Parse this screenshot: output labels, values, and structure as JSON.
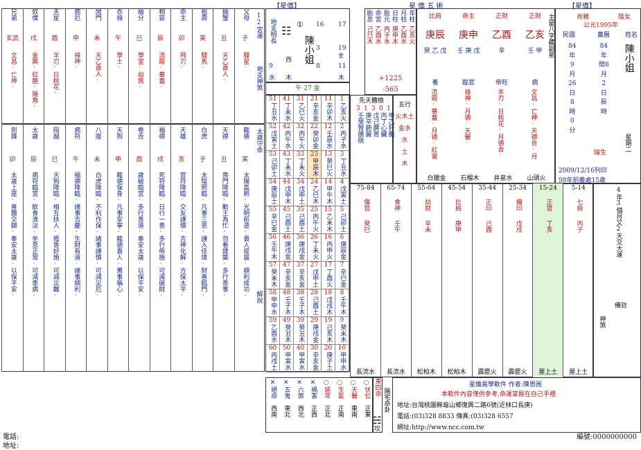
{
  "header": {
    "left": "【星僑】",
    "center": "星 僑 五 術",
    "right": "【星僑】"
  },
  "palaces_top": [
    {
      "name": "兄弟",
      "star": "玄武",
      "stem": "",
      "sub": "文昌·亡神·"
    },
    {
      "name": "奴僕",
      "star": "戌",
      "stem": "",
      "sub": "金輿·紅艷·陽角·"
    },
    {
      "name": "夫星",
      "star": "酉",
      "stem": "",
      "sub": "羊刃·日桃花·"
    },
    {
      "name": "病厄",
      "star": "申",
      "stem": "",
      "sub": "祿神·"
    },
    {
      "name": "閒門",
      "star": "未",
      "stem": "",
      "sub": "天乙貴人·"
    },
    {
      "name": "衣祿",
      "star": "午",
      "stem": "",
      "sub": "學士·"
    },
    {
      "name": "福分",
      "star": "巳",
      "stem": "",
      "sub": "學堂·劫煞·"
    },
    {
      "name": "相容",
      "star": "辰",
      "stem": "",
      "sub": "流霞·華蓋·"
    },
    {
      "name": "命主",
      "star": "卯",
      "stem": "",
      "sub": "飛刃·"
    },
    {
      "name": "祖壽",
      "star": "寅",
      "stem": "",
      "sub": "驛馬·"
    },
    {
      "name": "抽蟹",
      "star": "丑",
      "stem": "",
      "sub": "天乙貴人·"
    },
    {
      "name": "父母",
      "star": "子",
      "stem": "",
      "sub": "驛星·"
    }
  ],
  "palaces_mid": [
    {
      "name": "劍鋒",
      "b": "卯",
      "txt": "太歲上座·喜鵲交錦·奉安太歲·以保平安·"
    },
    {
      "name": "太歲",
      "b": "辰",
      "txt": "病符臨宮·飲食清淡·坐息正常·可減患病·"
    },
    {
      "name": "陌越",
      "b": "巳",
      "txt": "天狗降臨·相互扶人·擔香好施·可減災難·"
    },
    {
      "name": "病符",
      "b": "午",
      "txt": "福德降臨·諸事吉慶·生財有道·諸事順利·"
    },
    {
      "name": "八座",
      "b": "未",
      "txt": "白虎降臨·不利作保·諸事謹慎·可減災厄·"
    },
    {
      "name": "天狗",
      "b": "申",
      "txt": "龍德保身·凡事安寧·龍德貴人·萬事稱心·"
    },
    {
      "name": "卷舌",
      "b": "酉",
      "txt": "歲破臨宮·多行善道·奉安太歲·以保平安·"
    },
    {
      "name": "福德",
      "b": "戌",
      "txt": "死符降臨·日行一善·多行佈施·可減破財·"
    },
    {
      "name": "天雄",
      "b": "亥",
      "txt": "官符降臨·交友謹慎·吉神化解·方保太平·"
    },
    {
      "name": "白虎",
      "b": "子",
      "txt": "太陰照臨·凡事三思·謹入佳境·財喜臨門·"
    },
    {
      "name": "天德",
      "b": "丑",
      "txt": "喪門降臨·勤王為忙·勿看建築·多行善事·"
    },
    {
      "name": "龍德",
      "b": "寅",
      "txt": "太陽高照·光明前途·貴人提拔·順利成功·"
    }
  ],
  "left_labels": {
    "yunqi": "12宮運",
    "dizhi": "地支神煞",
    "taisui": "太歲守命",
    "jieshuo": "解說"
  },
  "name_block": {
    "circle": "①",
    "name": "陳小姐",
    "left_col": "地支明長",
    "nums_top": [
      "17",
      "19",
      "11"
    ],
    "nums_right": [
      "16",
      "3",
      "8"
    ],
    "l_small": [
      "9",
      "水"
    ],
    "r_small": [
      "金",
      "木"
    ],
    "mid_small": [
      "西",
      "木"
    ],
    "year_line": "午 27 金"
  },
  "liunian_header": "年 27 金",
  "mid_grid": [
    [
      "51丁丑水",
      "41丁未水",
      "31乙巳火",
      "21辛亥金",
      "11辛卯木",
      "1乙亥火"
    ],
    [
      "52戊寅土",
      "42丙午水",
      "32丙午火",
      "22癸卯金",
      "12壬辰水",
      "2丙子水"
    ],
    [
      "53己卯土",
      "43丁未水",
      "33丁未火",
      "23甲辰木",
      "13癸巳火",
      "3丁丑水"
    ],
    [
      "54庚辰土",
      "44戊申木",
      "34戊申土",
      "24乙巳木",
      "14甲午木",
      "4戊寅土"
    ],
    [
      "55辛巳金",
      "45己酉土",
      "35己酉土",
      "25丙午火",
      "15乙未木",
      "5己卯土"
    ],
    [
      "56壬午木",
      "46庚戌金",
      "36庚戌金",
      "26丁未火",
      "16丙申火",
      "6庚辰金"
    ],
    [
      "57癸未木",
      "47辛亥金",
      "37辛亥金",
      "27戊申土",
      "17丁酉火",
      "7辛巳金"
    ],
    [
      "58甲申水",
      "48壬子木",
      "38壬子木",
      "28己酉土",
      "18戊戌木",
      "8壬午木"
    ],
    [
      "59乙酉水",
      "49癸丑木",
      "39癸丑木",
      "29庚戌金",
      "19己亥木",
      "9癸未木"
    ],
    [
      "60丙戌土",
      "50甲寅水",
      "40甲寅水",
      "30辛亥金",
      "20庚子土",
      "10甲申水"
    ]
  ],
  "prebirth": {
    "title": "先天體檢",
    "rows": [
      "甲乙肝膽",
      "丙丁心臟",
      "戊己脾胃",
      "庚辛肺腸",
      "壬癸腎膀胱"
    ],
    "nums": [
      "1",
      "0",
      "3",
      "1",
      "3"
    ]
  },
  "fortune_cols": [
    "胎息",
    "命宮",
    "胎元",
    "日柱",
    "月柱",
    "年柱"
  ],
  "fortune_vals": [
    "己巳木",
    "乙酉水",
    "丙子水",
    "庚申木",
    "乙酉水",
    "乙亥火"
  ],
  "element_col": {
    "title": "五行",
    "items": [
      "火木土",
      "金水",
      "水",
      "土",
      "木"
    ]
  },
  "age_center": {
    "a": "+1225",
    "b": "-565"
  },
  "bazi": {
    "ten_gods": [
      "比肩",
      "命主",
      "正財",
      "正財"
    ],
    "stems": [
      "庚辰",
      "庚申",
      "乙酉",
      "乙亥"
    ],
    "hidden": [
      [
        "癸",
        "乙",
        "戊"
      ],
      [
        "壬",
        "庚",
        "戊"
      ],
      [
        "辛"
      ],
      [
        "壬",
        "甲"
      ]
    ],
    "shensha": [
      "流霞·華蓋·月德·紅鸞",
      "祿神·月德·天醫·",
      "羊刃·日桃花·月德合·",
      "文昌·亡神·天德合·月"
    ],
    "nayin": [
      "白鑞金",
      "石榴木",
      "井泉水",
      "山頭火"
    ],
    "state": [
      "養",
      "臨官",
      "帝旺",
      "病"
    ]
  },
  "birth": {
    "title": "公元1995年",
    "gong": "肖豬",
    "female": "陰女",
    "min": "民國",
    "nong": "農曆",
    "name_lab": "姓名",
    "year_g": "84",
    "year_n": "84",
    "month_g": "9",
    "month_n": "閏8",
    "day_g": "26",
    "day_n": "2",
    "hour_g": "8",
    "hour_n": "辰",
    "min_g": "0",
    "name": "陳小姐",
    "star": "瑞生",
    "week": "星期二",
    "print": "2009/12/16列印",
    "ninety": "98年前義處15歲"
  },
  "decades": [
    "75-84",
    "65-74",
    "55-64",
    "45-54",
    "35-44",
    "25-34",
    "15-24",
    "5-14"
  ],
  "decade_gods": [
    [
      "傷官",
      "食神",
      "劫財",
      "比肩",
      "正印",
      "偏印",
      "正官",
      "七殺"
    ],
    [
      "癸巳",
      "壬午",
      "辛未",
      "庚申",
      "己酉",
      "戊戌",
      "丁亥",
      "丙子"
    ]
  ],
  "decade_nayin": [
    "長流水",
    "長流水",
    "松柏木",
    "松柏木",
    "霹靂火",
    "霹靂火",
    "屋上土",
    "屋上土"
  ],
  "right_side": {
    "qisui": "4年3個月又2天交大運",
    "cheng": "備註",
    "shen": "神煞",
    "liu": "流"
  },
  "bottom_boxes": [
    "絕命",
    "五鬼",
    "六煞",
    "禍害",
    "延年",
    "生氣",
    "天醫",
    "伏位"
  ],
  "bottom_dirs": [
    "西南",
    "東北",
    "西北",
    "正西",
    "正北",
    "正南",
    "東南",
    "正東"
  ],
  "east_four": "東四命",
  "yangzhai": "陽宅命卦",
  "kan": "坎",
  "company": {
    "title": "星僑易學軟件 作者:陳恩困",
    "tagline": "本軟件內容僅供參考,命運掌握在自己手裡",
    "addr": "地址:台灣桃園縣龜山鄉復興二路6號(近林口長庚)",
    "tel": "電話:(03)328 8833 傳真:(03)328 6557",
    "web": "網址:http://www.ncc.com.tw"
  },
  "footer": {
    "phone": "電話:",
    "addr": "地址:",
    "code_label": "編號:",
    "code": "0000000000"
  }
}
